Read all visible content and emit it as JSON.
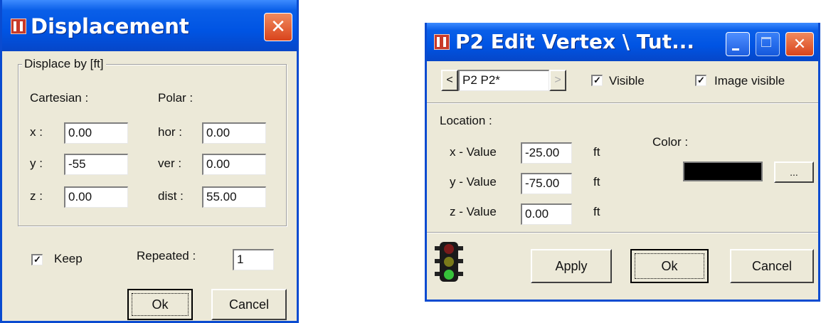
{
  "displacement_dialog": {
    "title": "Displacement",
    "close_glyph": "✕",
    "icon": "app-logo-icon",
    "group_title": "Displace by [ft]",
    "cartesian": {
      "heading": "Cartesian :",
      "x_label": "x :",
      "x_value": "0.00",
      "y_label": "y :",
      "y_value": "-55",
      "z_label": "z :",
      "z_value": "0.00"
    },
    "polar": {
      "heading": "Polar :",
      "hor_label": "hor :",
      "hor_value": "0.00",
      "ver_label": "ver :",
      "ver_value": "0.00",
      "dist_label": "dist :",
      "dist_value": "55.00"
    },
    "keep_label": "Keep",
    "keep_checked": true,
    "check_glyph": "✓",
    "repeated_label": "Repeated :",
    "repeated_value": "1",
    "ok_label": "Ok",
    "cancel_label": "Cancel"
  },
  "vertex_dialog": {
    "title": "P2 Edit Vertex \\ Tut...",
    "close_glyph": "✕",
    "prev_glyph": "<",
    "next_glyph": ">",
    "name_value": "P2 P2*",
    "visible_label": "Visible",
    "visible_checked": true,
    "image_visible_label": "Image visible",
    "image_visible_checked": true,
    "check_glyph": "✓",
    "location_heading": "Location :",
    "x_label": "x - Value",
    "x_value": "-25.00",
    "y_label": "y - Value",
    "y_value": "-75.00",
    "z_label": "z - Value",
    "z_value": "0.00",
    "unit": "ft",
    "color_heading": "Color :",
    "color_value": "#000000",
    "color_picker_label": "...",
    "apply_label": "Apply",
    "ok_label": "Ok",
    "cancel_label": "Cancel",
    "status_icon": "traffic-light-icon"
  },
  "colors": {
    "titlebar_blue": "#0054e3",
    "dialog_face": "#ece9d8",
    "close_red": "#d9441c"
  }
}
